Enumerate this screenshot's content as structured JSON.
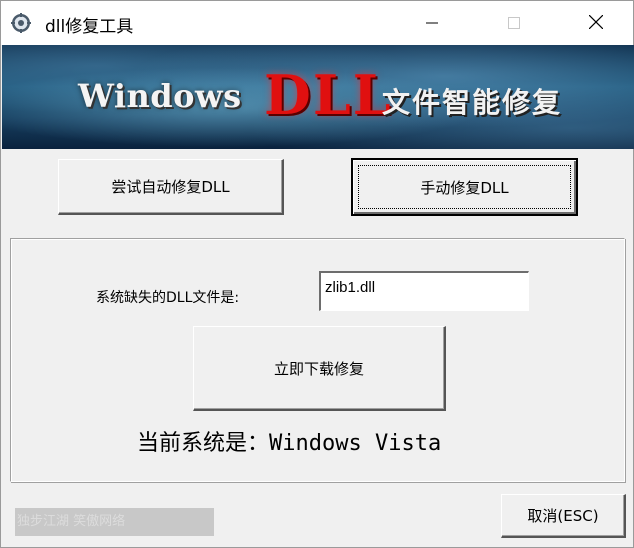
{
  "window": {
    "title": "dll修复工具",
    "app_icon": "gear-icon",
    "controls": {
      "minimize": "minimize-icon",
      "maximize": "maximize-icon",
      "close": "close-icon"
    }
  },
  "banner": {
    "word1": "Windows",
    "word2": "DLL",
    "word3": "文件智能修复"
  },
  "buttons": {
    "auto_repair": "尝试自动修复DLL",
    "manual_repair": "手动修复DLL",
    "download_repair": "立即下载修复",
    "cancel": "取消(ESC)"
  },
  "main": {
    "missing_label": "系统缺失的DLL文件是:",
    "missing_dll_value": "zlib1.dll",
    "current_system": "当前系统是：Windows Vista"
  },
  "footer": {
    "link_text": "独步江湖 笑傲网络"
  },
  "colors": {
    "window_bg": "#f0f0f0",
    "dll_red": "#e01010",
    "banner_blue": "#1d5578"
  }
}
